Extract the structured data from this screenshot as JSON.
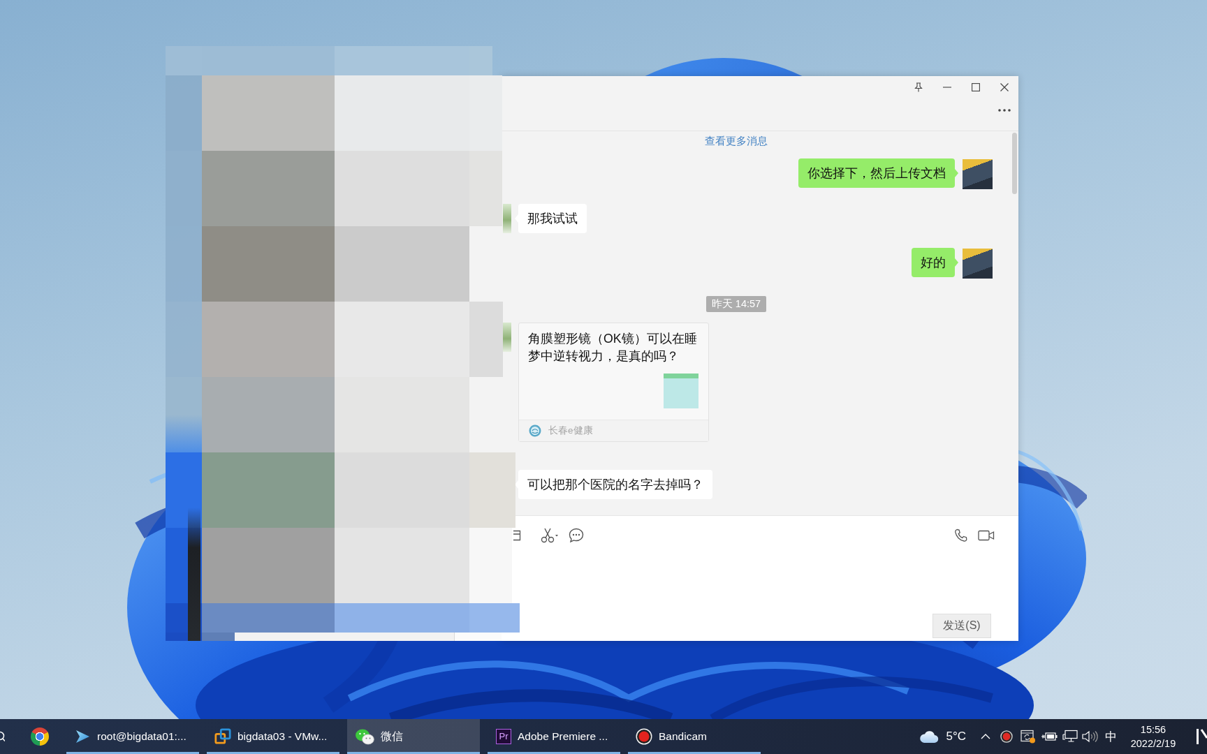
{
  "desktop": {
    "chat_window": {
      "load_more": "查看更多消息",
      "messages": [
        {
          "kind": "sent",
          "text": "你选择下，然后上传文档"
        },
        {
          "kind": "received",
          "text": "那我试试"
        },
        {
          "kind": "sent",
          "text": "好的"
        },
        {
          "kind": "time",
          "text": "昨天 14:57"
        },
        {
          "kind": "card",
          "title": "角膜塑形镜（OK镜）可以在睡梦中逆转视力，是真的吗？",
          "source": "长春e健康"
        },
        {
          "kind": "received",
          "text": "可以把那个医院的名字去掉吗？"
        }
      ],
      "send_button": "发送(S)"
    },
    "taskbar": {
      "items": [
        {
          "label": "root@bigdata01:...",
          "selected": false
        },
        {
          "label": "bigdata03 - VMw...",
          "selected": false
        },
        {
          "label": "微信",
          "selected": true
        },
        {
          "label": "Adobe Premiere ...",
          "icon_text": "Pr",
          "selected": false
        },
        {
          "label": "Bandicam",
          "selected": false
        }
      ],
      "weather": "5°C",
      "ime": "中",
      "time": "15:56",
      "date": "2022/2/19"
    }
  }
}
